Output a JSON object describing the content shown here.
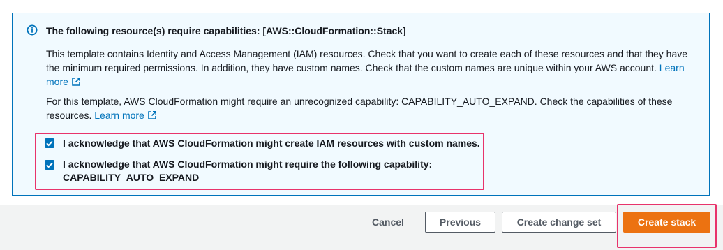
{
  "alert": {
    "title": "The following resource(s) require capabilities: [AWS::CloudFormation::Stack]",
    "paragraph1": "This template contains Identity and Access Management (IAM) resources. Check that you want to create each of these resources and that they have the minimum required permissions. In addition, they have custom names. Check that the custom names are unique within your AWS account.",
    "paragraph2": "For this template, AWS CloudFormation might require an unrecognized capability: CAPABILITY_AUTO_EXPAND. Check the capabilities of these resources.",
    "learn_more_label": "Learn more"
  },
  "acknowledgements": [
    {
      "label": "I acknowledge that AWS CloudFormation might create IAM resources with custom names.",
      "checked": true
    },
    {
      "label": "I acknowledge that AWS CloudFormation might require the following capability: CAPABILITY_AUTO_EXPAND",
      "checked": true
    }
  ],
  "footer": {
    "cancel_label": "Cancel",
    "previous_label": "Previous",
    "create_change_set_label": "Create change set",
    "create_stack_label": "Create stack"
  },
  "colors": {
    "info_blue": "#0073bb",
    "primary_orange": "#ec7211",
    "highlight_pink": "#e8336b",
    "alert_background": "#f1faff"
  }
}
